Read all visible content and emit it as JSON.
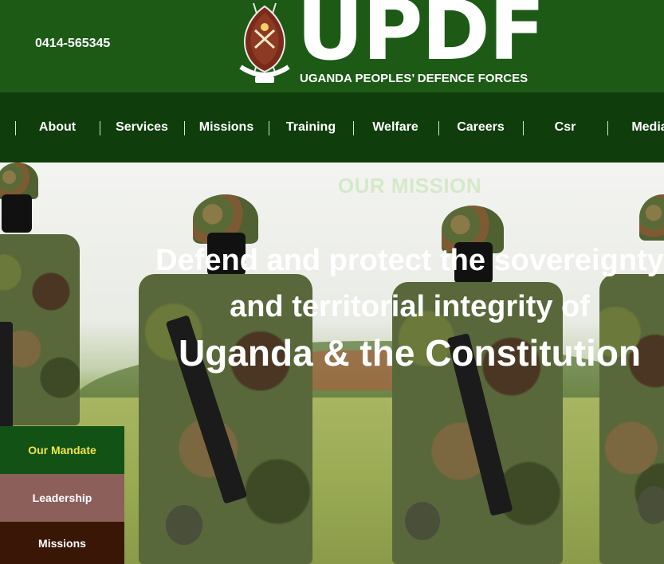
{
  "header": {
    "phone": "0414-565345",
    "logo_title": "UPDF",
    "logo_subtitle": "UGANDA PEOPLES’ DEFENCE FORCES",
    "emblem_icon": "updf-emblem-icon"
  },
  "nav": {
    "items": [
      {
        "label": "About"
      },
      {
        "label": "Services"
      },
      {
        "label": "Missions"
      },
      {
        "label": "Training"
      },
      {
        "label": "Welfare"
      },
      {
        "label": "Careers"
      },
      {
        "label": "Csr"
      },
      {
        "label": "Media"
      }
    ]
  },
  "hero": {
    "heading": "OUR MISSION",
    "line1": "Defend and protect the sovereignty",
    "line2": "and territorial integrity of",
    "line3": "Uganda & the Constitution"
  },
  "side_menu": {
    "mandate": "Our Mandate",
    "leadership": "Leadership",
    "missions": "Missions"
  },
  "colors": {
    "header_green": "#1c5a16",
    "nav_green": "#0f3e0c",
    "mandate_bg": "#125214",
    "mandate_text": "#f0e64a",
    "leadership_bg": "#8c5f5b",
    "missions_bg": "#3a1606"
  }
}
